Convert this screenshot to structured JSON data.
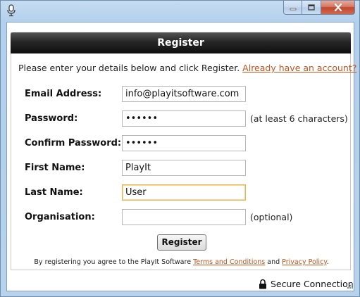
{
  "window": {
    "title": ""
  },
  "panel": {
    "header": "Register",
    "intro_text": "Please enter your details below and click Register.",
    "have_account_link": "Already have an account?"
  },
  "form": {
    "email": {
      "label": "Email Address:",
      "value": "info@playitsoftware.com"
    },
    "password": {
      "label": "Password:",
      "value": "••••••",
      "hint": "(at least 6 characters)"
    },
    "confirm_password": {
      "label": "Confirm Password:",
      "value": "••••••"
    },
    "first_name": {
      "label": "First Name:",
      "value": "PlayIt"
    },
    "last_name": {
      "label": "Last Name:",
      "value": "User"
    },
    "organisation": {
      "label": "Organisation:",
      "value": "",
      "hint": "(optional)"
    },
    "submit_label": "Register"
  },
  "terms": {
    "prefix": "By registering you agree to the PlayIt Software ",
    "terms_link": "Terms and Conditions",
    "middle": " and ",
    "privacy_link": "Privacy Policy",
    "suffix": "."
  },
  "status": {
    "secure_text": "Secure Connection"
  },
  "colors": {
    "link": "#c0541f",
    "header_bg": "#1a1a1a",
    "focus_border": "#e6b34c"
  }
}
